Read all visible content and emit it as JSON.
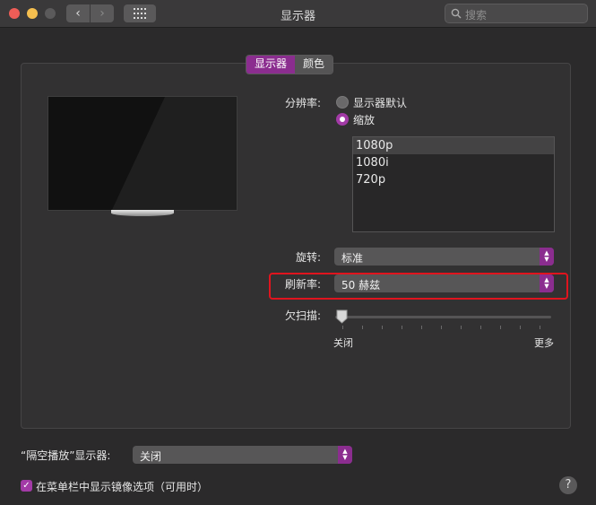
{
  "window": {
    "title": "显示器"
  },
  "search": {
    "placeholder": "搜索"
  },
  "tabs": [
    {
      "label": "显示器"
    },
    {
      "label": "颜色"
    }
  ],
  "resolution": {
    "label": "分辨率:",
    "options": [
      {
        "label": "显示器默认",
        "selected": false
      },
      {
        "label": "缩放",
        "selected": true
      }
    ],
    "list": [
      "1080p",
      "1080i",
      "720p"
    ],
    "list_selected": "1080p"
  },
  "rotation": {
    "label": "旋转:",
    "value": "标准"
  },
  "refresh_rate": {
    "label": "刷新率:",
    "value": "50 赫兹"
  },
  "underscan": {
    "label": "欠扫描:",
    "min_label": "关闭",
    "max_label": "更多",
    "value": 0
  },
  "airplay": {
    "label": "“隔空播放”显示器:",
    "value": "关闭"
  },
  "mirror_option": {
    "label": "在菜单栏中显示镜像选项（可用时）",
    "checked": true
  },
  "help": {
    "label": "?"
  },
  "colors": {
    "accent": "#8b2d8f",
    "highlight": "#e0141e"
  }
}
